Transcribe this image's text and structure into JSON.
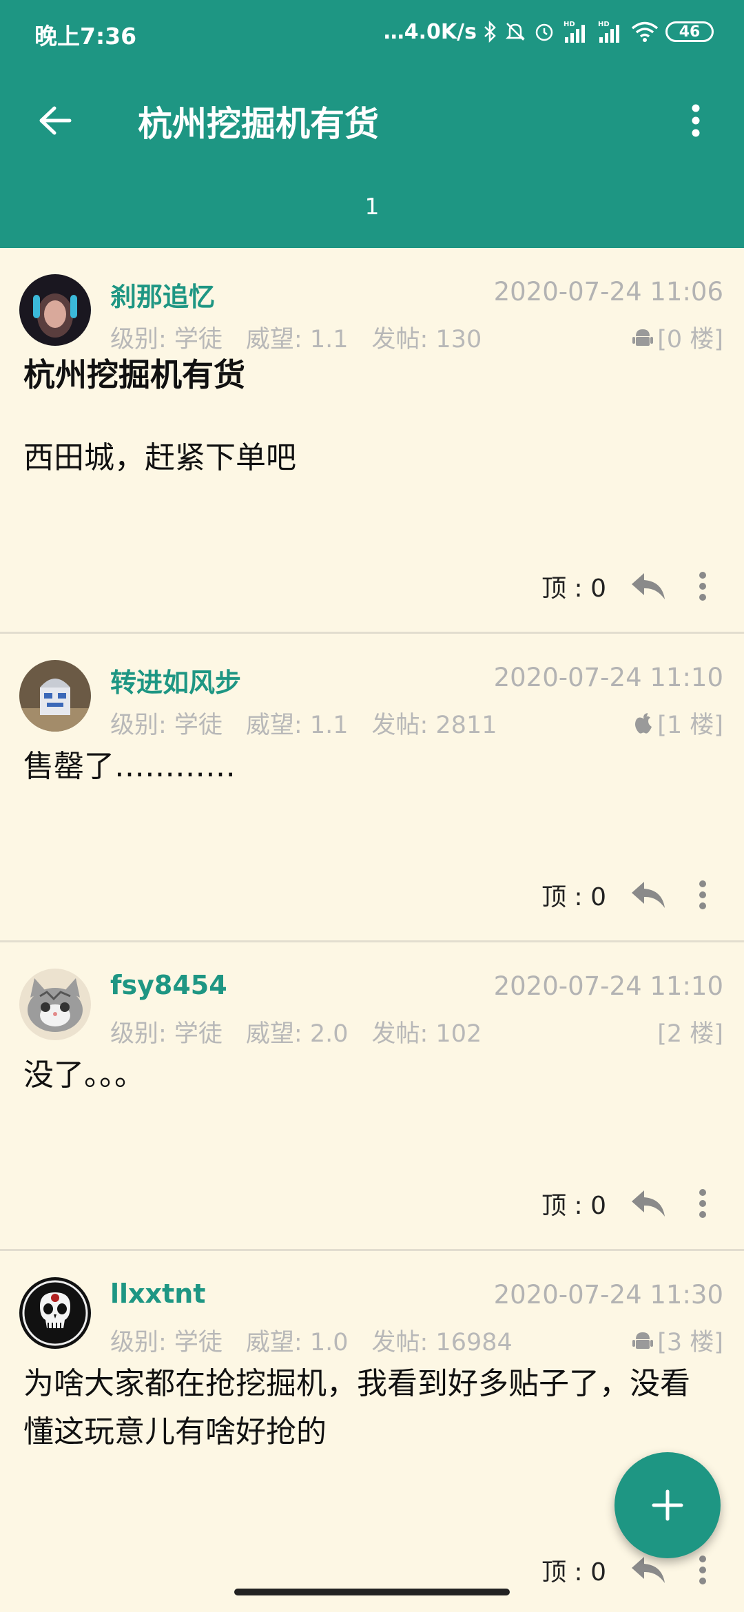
{
  "status_bar": {
    "time": "晚上7:36",
    "speed": "…4.0K/s",
    "hd1": "HD",
    "hd2": "HD",
    "battery": "46"
  },
  "app_bar": {
    "title": "杭州挖掘机有货",
    "page_tab": "1",
    "icons": [
      "back-arrow-icon",
      "more-vert-icon"
    ]
  },
  "posts": [
    {
      "username": "刹那追忆",
      "time": "2020-07-24 11:06",
      "level": "级别: 学徒",
      "prestige": "威望: 1.1",
      "post_count": "发帖: 130",
      "device_icon": "android-icon",
      "floor": "[0 楼]",
      "title": "杭州挖掘机有货",
      "body": "西田城，赶紧下单吧",
      "top": "顶 : 0"
    },
    {
      "username": "转进如风步",
      "time": "2020-07-24 11:10",
      "level": "级别: 学徒",
      "prestige": "威望: 1.1",
      "post_count": "发帖: 2811",
      "device_icon": "apple-icon",
      "floor": "[1 楼]",
      "body": "售罄了…………",
      "top": "顶 : 0"
    },
    {
      "username": "fsy8454",
      "time": "2020-07-24 11:10",
      "level": "级别: 学徒",
      "prestige": "威望: 2.0",
      "post_count": "发帖: 102",
      "floor": "[2 楼]",
      "body": "没了。。。",
      "top": "顶 : 0"
    },
    {
      "username": "llxxtnt",
      "time": "2020-07-24 11:30",
      "level": "级别: 学徒",
      "prestige": "威望: 1.0",
      "post_count": "发帖: 16984",
      "device_icon": "android-icon",
      "floor": "[3 楼]",
      "body": "为啥大家都在抢挖掘机，我看到好多贴子了，没看懂这玩意儿有啥好抢的",
      "top": "顶 : 0"
    }
  ],
  "fab": {
    "icon": "plus-icon"
  },
  "colors": {
    "primary": "#1e9683",
    "background": "#fdf7e4",
    "meta_text": "#b8b8b8"
  }
}
